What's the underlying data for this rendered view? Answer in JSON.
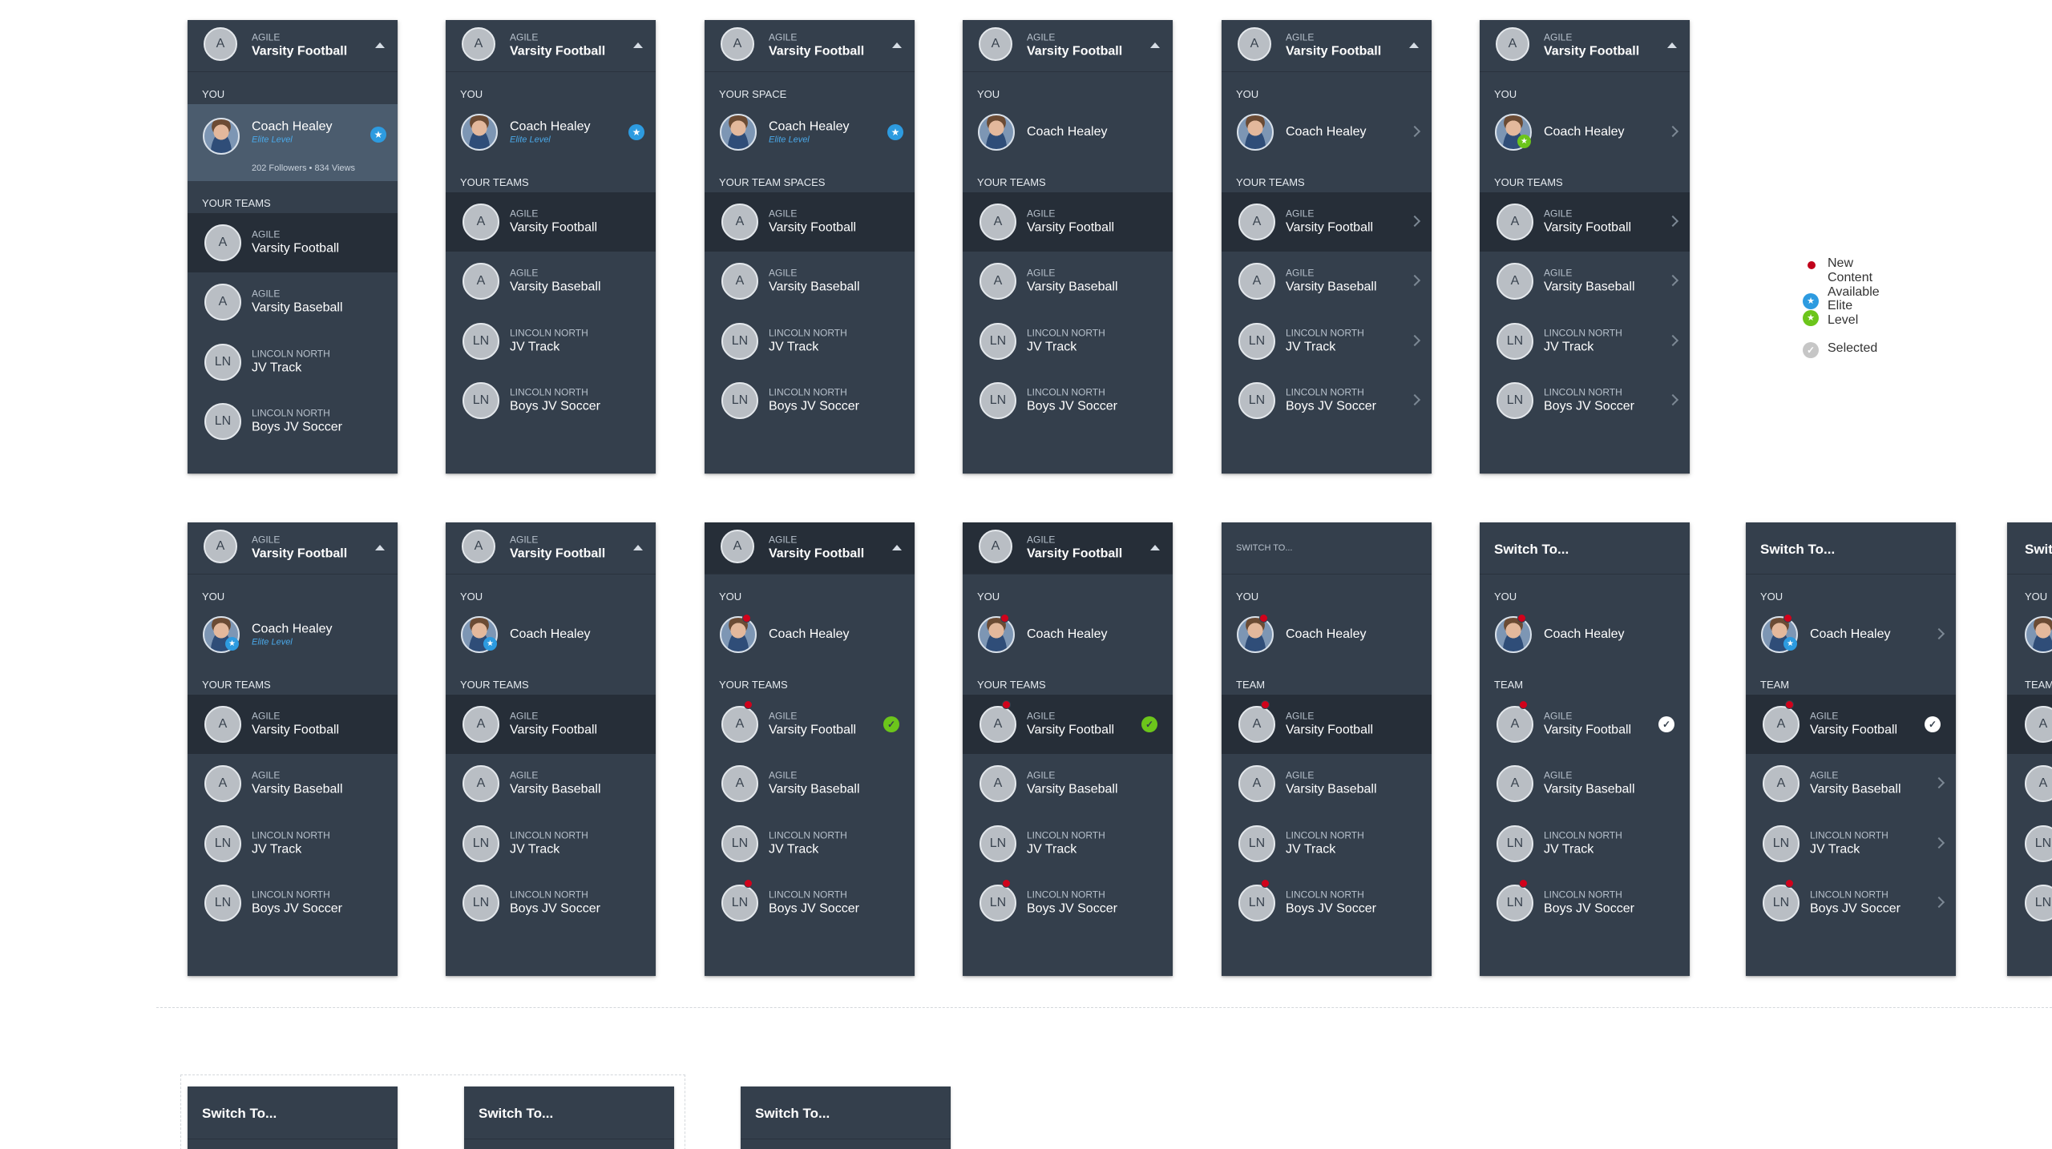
{
  "header_default": {
    "initial": "A",
    "org": "AGILE",
    "team": "Varsity Football"
  },
  "sections": {
    "you": "YOU",
    "your_space": "YOUR SPACE",
    "your_teams": "YOUR TEAMS",
    "your_team_spaces": "YOUR TEAM SPACES",
    "team": "TEAM"
  },
  "user": {
    "name": "Coach Healey",
    "level": "Elite Level",
    "stats": "202 Followers • 834 Views"
  },
  "teams": [
    {
      "initial": "A",
      "org": "AGILE",
      "name": "Varsity Football"
    },
    {
      "initial": "A",
      "org": "AGILE",
      "name": "Varsity Baseball"
    },
    {
      "initial": "LN",
      "org": "LINCOLN NORTH",
      "name": "JV Track"
    },
    {
      "initial": "LN",
      "org": "LINCOLN NORTH",
      "name": "Boys JV Soccer"
    }
  ],
  "switch": {
    "small": "SWITCH TO...",
    "bold": "Switch To..."
  },
  "legend": [
    {
      "label": "New Content Available",
      "color": "#c0001a"
    },
    {
      "label": "Elite Level",
      "colors": [
        "#2d9be0",
        "#6cc51b"
      ]
    },
    {
      "label": "Selected",
      "color": "#c6c6c6"
    }
  ],
  "icons": {
    "star": "★",
    "check": "✓"
  },
  "colors": {
    "panel": "#343f4c",
    "panel_dark": "#262e38",
    "highlight": "#4b5c6e",
    "new_content": "#d0021b",
    "elite_blue": "#2d9be0",
    "elite_green": "#6cc51b"
  }
}
